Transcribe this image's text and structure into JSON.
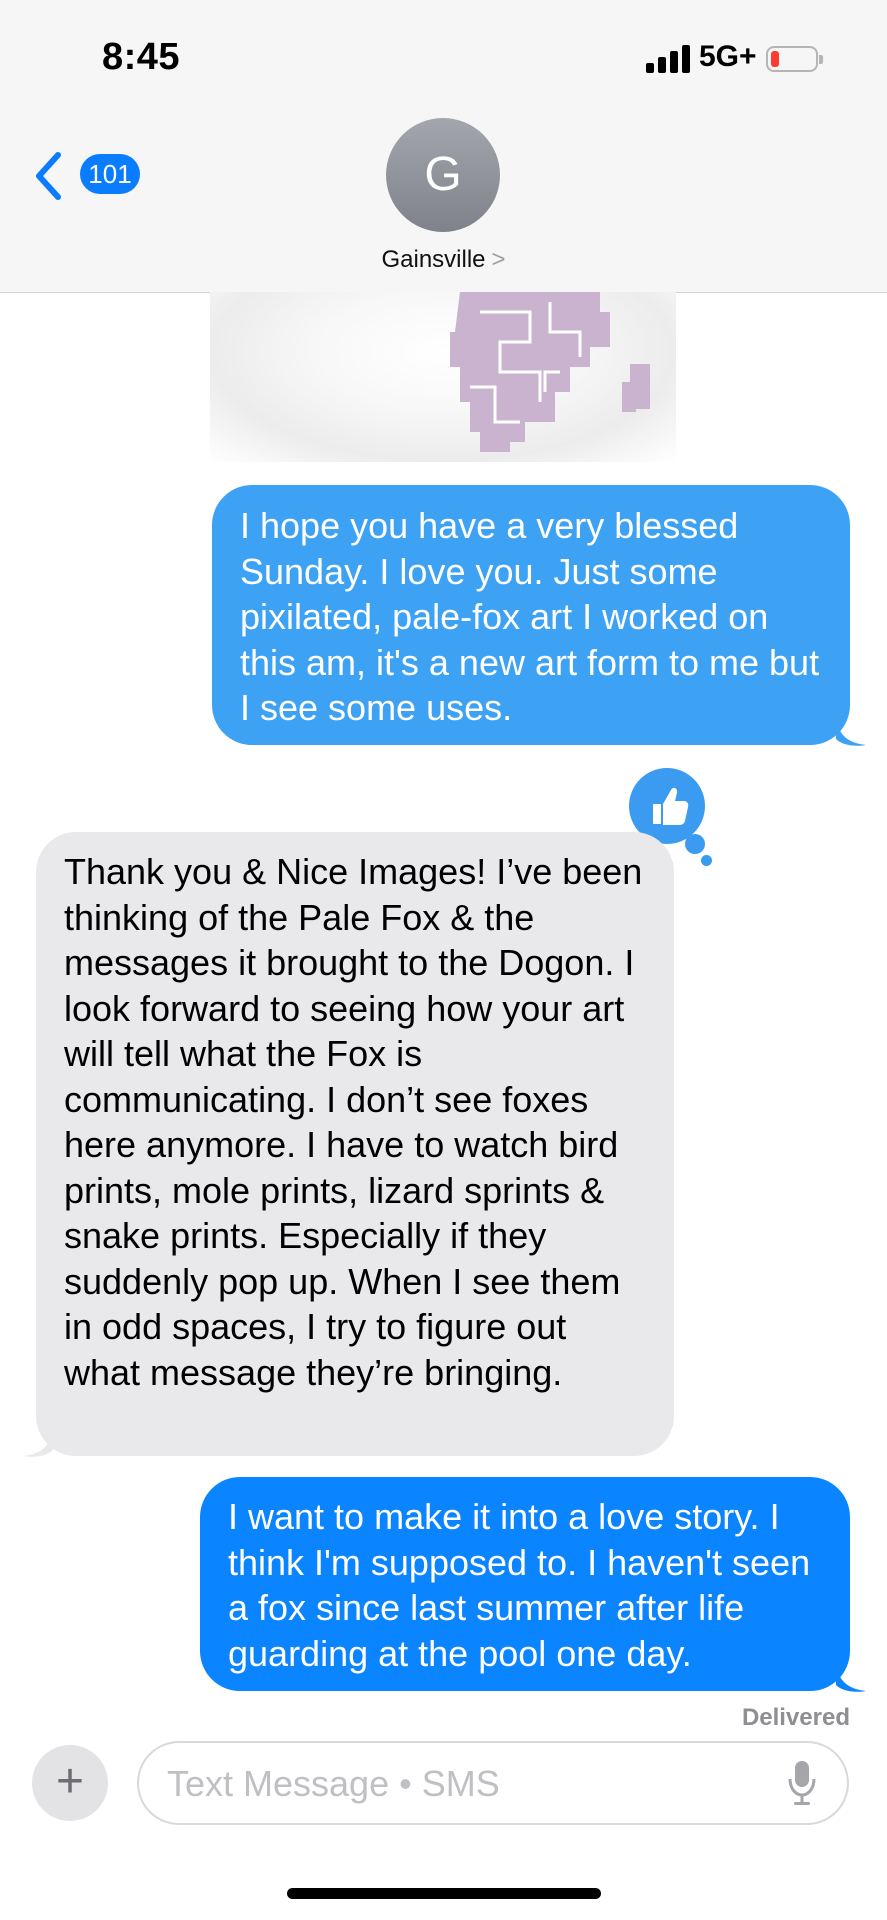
{
  "status_bar": {
    "time": "8:45",
    "network": "5G+"
  },
  "header": {
    "unread_count": "101",
    "avatar_initial": "G",
    "contact_name": "Gainsville",
    "contact_chevron": ">"
  },
  "messages": [
    {
      "from": "me",
      "text": "I hope you have a very blessed Sunday. I love you. Just some pixilated, pale-fox art I worked on this am, it's a new art form to me but I see some uses."
    },
    {
      "from": "them",
      "text": "Thank you & Nice Images! I’ve been thinking of the Pale Fox & the messages it brought to the Dogon. I look forward to seeing how your art will tell what the Fox is communicating.   I don’t see foxes here anymore. I have to watch bird prints, mole prints, lizard sprints & snake prints. Especially if they suddenly pop up. When I see them in odd spaces, I try to figure out what message they’re bringing."
    },
    {
      "from": "me",
      "text": "I want to make it into a love story. I think I'm supposed to. I haven't seen a fox since last summer after life guarding at the pool one day."
    }
  ],
  "tapback": {
    "icon": "thumbs-up-icon"
  },
  "delivered_label": "Delivered",
  "composer": {
    "plus": "+",
    "placeholder": "Text Message • SMS",
    "mic_icon": "mic-icon"
  },
  "colors": {
    "sent": "#0a84ff",
    "sent_light": "#3ea2f4",
    "received": "#e9e9eb",
    "accent": "#0a7cff"
  }
}
